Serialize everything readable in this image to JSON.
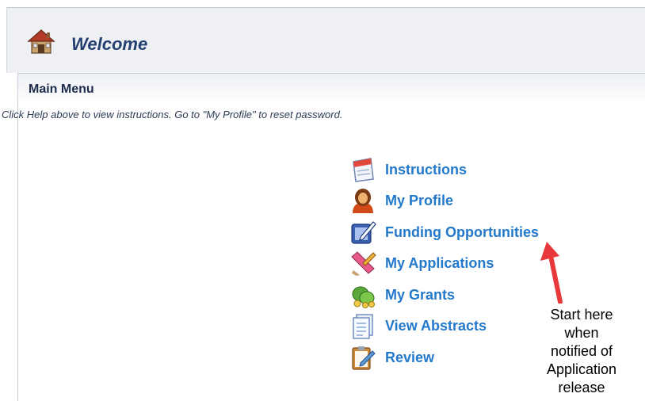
{
  "header": {
    "title": "Welcome",
    "icon": "home-icon"
  },
  "panel": {
    "title": "Main Menu",
    "help_text": "Click Help above to view instructions. Go to \"My Profile\" to reset password."
  },
  "menu": {
    "items": [
      {
        "label": "Instructions",
        "icon": "instructions-icon"
      },
      {
        "label": "My Profile",
        "icon": "profile-icon"
      },
      {
        "label": "Funding Opportunities",
        "icon": "funding-opportunities-icon"
      },
      {
        "label": "My Applications",
        "icon": "applications-icon"
      },
      {
        "label": "My Grants",
        "icon": "grants-icon"
      },
      {
        "label": "View Abstracts",
        "icon": "abstracts-icon"
      },
      {
        "label": "Review",
        "icon": "review-icon"
      }
    ]
  },
  "annotation": {
    "lines": [
      "Start here",
      "when",
      "notified of",
      "Application",
      "release"
    ],
    "arrow_color": "#e8383b"
  },
  "colors": {
    "link": "#2379cc",
    "title": "#243f71",
    "header_bg": "#eef0f3"
  }
}
